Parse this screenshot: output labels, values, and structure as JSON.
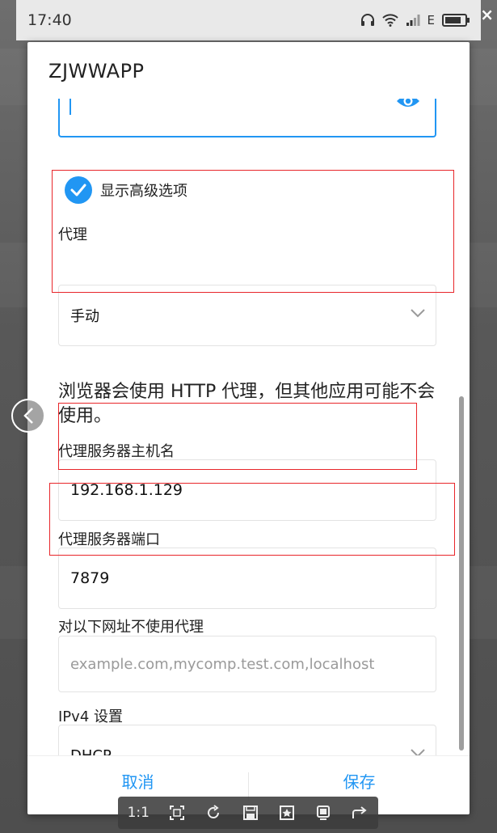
{
  "status_bar": {
    "time": "17:40",
    "network_type": "E"
  },
  "overlay": {
    "close_label": "×"
  },
  "dialog": {
    "title": "ZJWWAPP",
    "advanced_options": {
      "label": "显示高级选项",
      "checked": true
    },
    "proxy": {
      "label": "代理",
      "selected": "手动"
    },
    "info_text": "浏览器会使用 HTTP 代理，但其他应用可能不会使用。",
    "proxy_host": {
      "label": "代理服务器主机名",
      "value": "192.168.1.129"
    },
    "proxy_port": {
      "label": "代理服务器端口",
      "value": "7879"
    },
    "bypass": {
      "label": "对以下网址不使用代理",
      "placeholder": "example.com,mycomp.test.com,localhost"
    },
    "ipv4": {
      "label": "IPv4 设置",
      "selected": "DHCP"
    },
    "buttons": {
      "cancel": "取消",
      "save": "保存"
    }
  },
  "viewer_toolbar": {
    "zoom_label": "1:1",
    "icons": [
      "fit-screen-icon",
      "rotate-icon",
      "save-icon",
      "bookmark-icon",
      "fullscreen-icon",
      "share-icon"
    ]
  },
  "colors": {
    "accent": "#2196f3",
    "highlight_box": "#e8262a"
  }
}
